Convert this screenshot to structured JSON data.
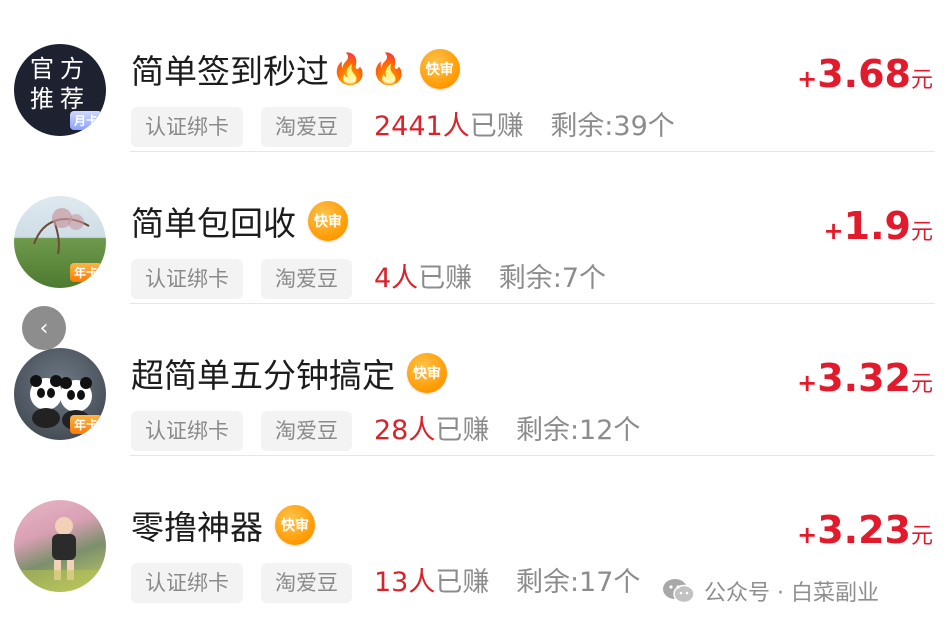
{
  "tasks": [
    {
      "title": "简单签到秒过",
      "fire_icons": 2,
      "badge": "快审",
      "tags": [
        "认证绑卡",
        "淘爱豆"
      ],
      "earned_count": "2441人",
      "earned_suffix": "已赚",
      "remaining": "剩余:39个",
      "price_plus": "+",
      "price": "3.68",
      "price_unit": "元",
      "avatar_text_lines": [
        "官方",
        "推荐"
      ],
      "avatar_card": "月卡"
    },
    {
      "title": "简单包回收",
      "badge": "快审",
      "tags": [
        "认证绑卡",
        "淘爱豆"
      ],
      "earned_count": "4人",
      "earned_suffix": "已赚",
      "remaining": "剩余:7个",
      "price_plus": "+",
      "price": "1.9",
      "price_unit": "元",
      "avatar_card": "年卡"
    },
    {
      "title": "超简单五分钟搞定",
      "badge": "快审",
      "tags": [
        "认证绑卡",
        "淘爱豆"
      ],
      "earned_count": "28人",
      "earned_suffix": "已赚",
      "remaining": "剩余:12个",
      "price_plus": "+",
      "price": "3.32",
      "price_unit": "元",
      "avatar_card": "年卡"
    },
    {
      "title": "零撸神器",
      "badge": "快审",
      "tags": [
        "认证绑卡",
        "淘爱豆"
      ],
      "earned_count": "13人",
      "earned_suffix": "已赚",
      "remaining": "剩余:17个",
      "price_plus": "+",
      "price": "3.23",
      "price_unit": "元"
    }
  ],
  "back_icon": "chevron-left-icon",
  "watermark": {
    "text": "公众号 · 白菜副业",
    "icon": "wechat-icon"
  },
  "colors": {
    "price": "#e21b2c",
    "earned_number": "#d8232a",
    "badge": "#ff9900"
  }
}
